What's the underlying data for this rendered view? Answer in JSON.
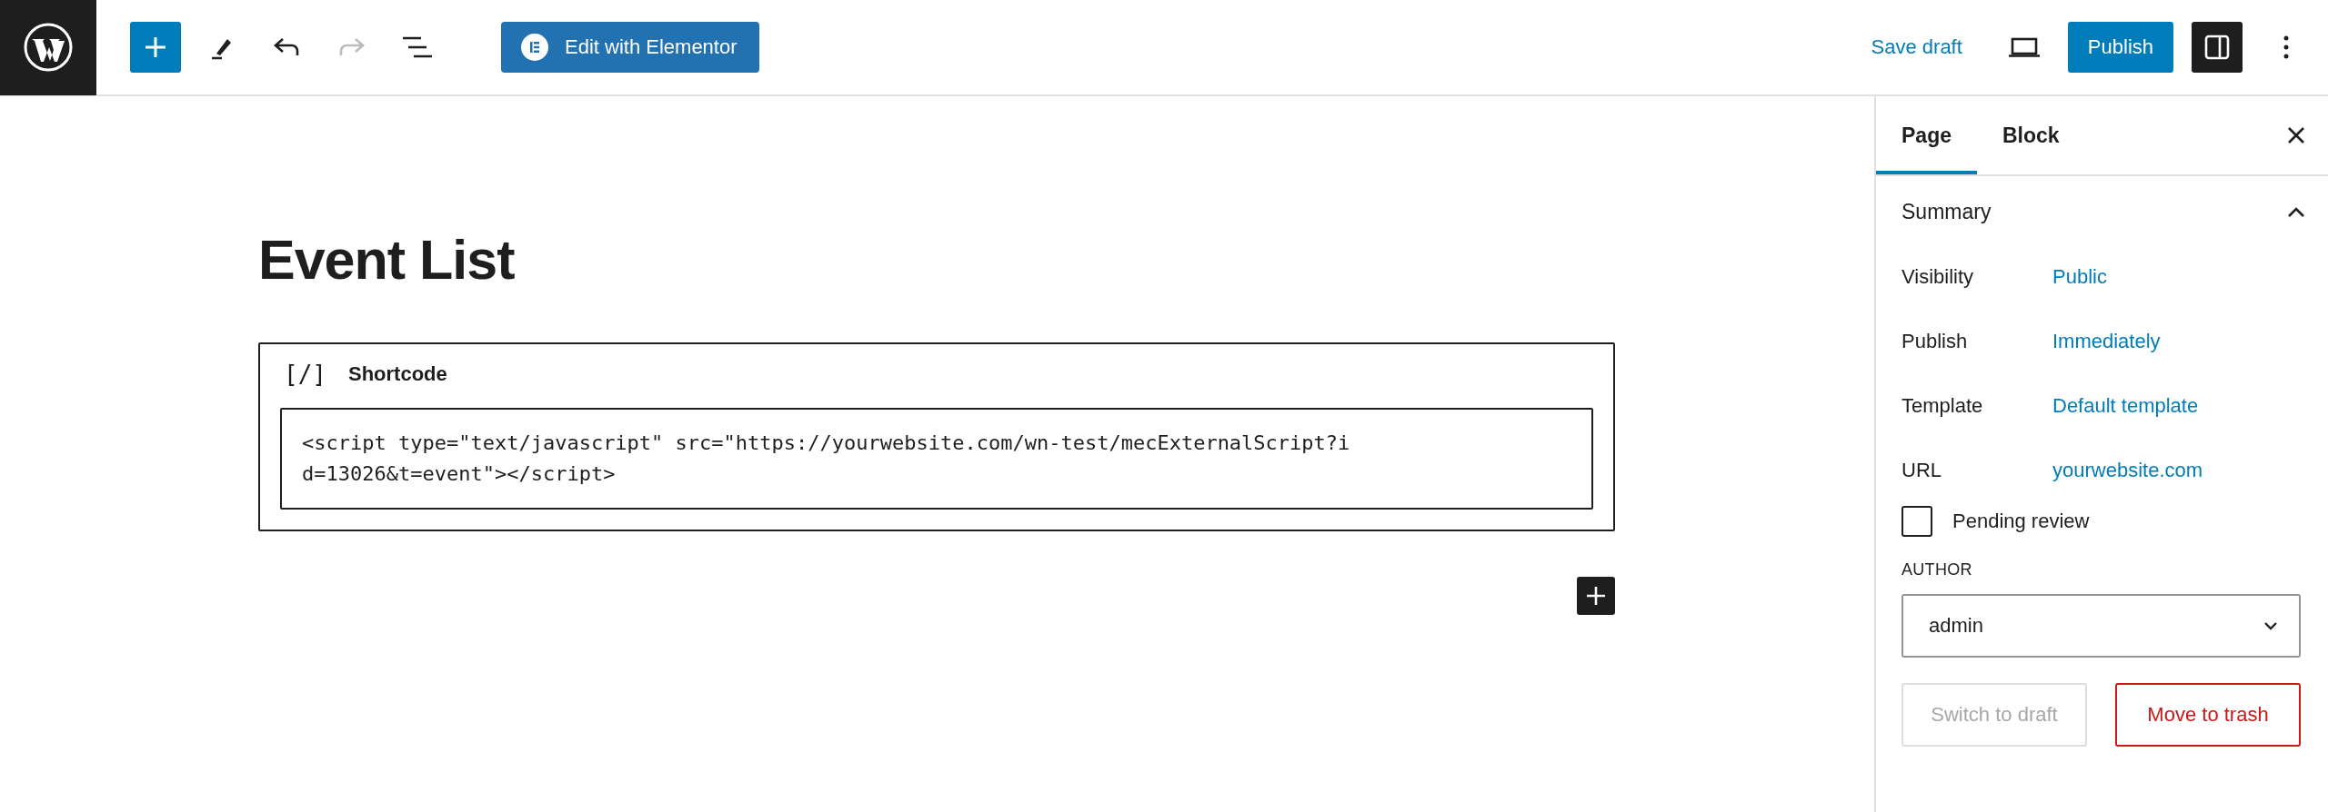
{
  "toolbar": {
    "elementor_button": "Edit with Elementor",
    "undo": {
      "disabled": false
    },
    "redo": {
      "disabled": true
    },
    "save_draft": "Save draft",
    "publish": "Publish",
    "sidebar_toggle": {
      "on": true
    }
  },
  "editor": {
    "title": "Event List",
    "block": {
      "label": "Shortcode",
      "icon_text": "[/]",
      "code": "<script type=\"text/javascript\" src=\"https://yourwebsite.com/wn-test/mecExternalScript?id=13026&t=event\"></script>",
      "selected": true
    }
  },
  "sidebar": {
    "tabs": [
      {
        "label": "Page",
        "selected": true
      },
      {
        "label": "Block",
        "selected": false
      }
    ],
    "summary": {
      "title": "Summary",
      "expanded": true,
      "rows": [
        {
          "label": "Visibility",
          "value": "Public"
        },
        {
          "label": "Publish",
          "value": "Immediately"
        },
        {
          "label": "Template",
          "value": "Default template"
        },
        {
          "label": "URL",
          "value": "yourwebsite.com"
        }
      ],
      "pending_review": {
        "label": "Pending review",
        "checked": false
      },
      "author": {
        "label": "AUTHOR",
        "value": "admin"
      },
      "buttons": [
        {
          "label": "Switch to draft",
          "kind": "secondary",
          "disabled": true
        },
        {
          "label": "Move to trash",
          "kind": "danger",
          "disabled": false
        }
      ]
    }
  }
}
